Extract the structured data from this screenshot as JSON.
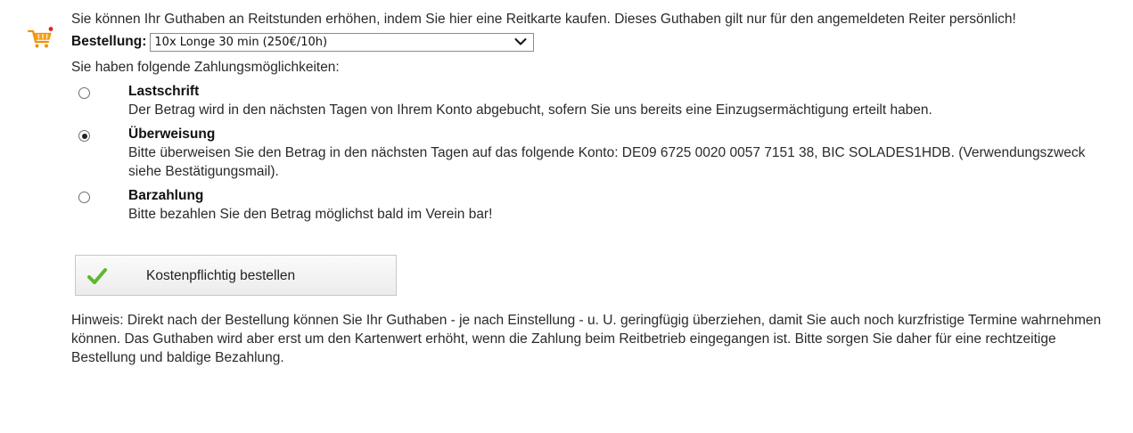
{
  "intro": {
    "icon": "shopping-cart-icon",
    "text": "Sie können Ihr Guthaben an Reitstunden erhöhen, indem Sie hier eine Reitkarte kaufen. Dieses Guthaben gilt nur für den angemeldeten Reiter persönlich!"
  },
  "order": {
    "label": "Bestellung:",
    "selected": "10x Longe 30 min (250€/10h)"
  },
  "payment": {
    "intro": "Sie haben folgende Zahlungsmöglichkeiten:",
    "options": [
      {
        "title": "Lastschrift",
        "description": "Der Betrag wird in den nächsten Tagen von Ihrem Konto abgebucht, sofern Sie uns bereits eine Einzugsermächtigung erteilt haben.",
        "checked": false
      },
      {
        "title": "Überweisung",
        "description": "Bitte überweisen Sie den Betrag in den nächsten Tagen auf das folgende Konto: DE09 6725 0020 0057 7151 38, BIC SOLADES1HDB. (Verwendungszweck siehe Bestätigungsmail).",
        "checked": true
      },
      {
        "title": "Barzahlung",
        "description": "Bitte bezahlen Sie den Betrag möglichst bald im Verein bar!",
        "checked": false
      }
    ]
  },
  "button": {
    "label": "Kostenpflichtig bestellen",
    "icon": "checkmark-icon"
  },
  "hint": {
    "text": "Hinweis: Direkt nach der Bestellung können Sie Ihr Guthaben - je nach Einstellung - u. U. geringfügig überziehen, damit Sie auch noch kurzfristige Termine wahrnehmen können. Das Guthaben wird aber erst um den Kartenwert erhöht, wenn die Zahlung beim Reitbetrieb eingegangen ist. Bitte sorgen Sie daher für eine rechtzeitige Bestellung und baldige Bezahlung."
  },
  "colors": {
    "cart_orange": "#f39200",
    "cart_red": "#e2231a",
    "check_green": "#5cb82c"
  }
}
